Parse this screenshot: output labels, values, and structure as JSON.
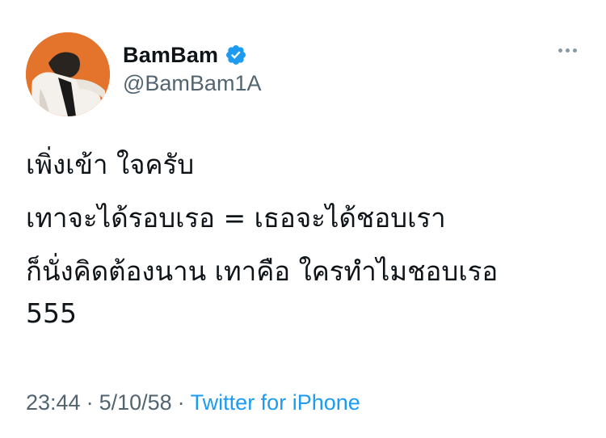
{
  "author": {
    "display_name": "BamBam",
    "handle": "@BamBam1A",
    "verified_icon": "verified-badge-icon",
    "avatar_color": "#e4732c"
  },
  "tweet": {
    "lines": [
      "เพิ่งเข้า ใจครับ",
      "เทาจะได้รอบเรอ = เธอจะได้ชอบเรา",
      "ก็นั่งคิดต้องนาน เทาคือ ใครทำไมชอบเรอ",
      "555"
    ]
  },
  "meta": {
    "time": "23:44",
    "separator": "·",
    "date": "5/10/58",
    "source": "Twitter for iPhone"
  },
  "colors": {
    "accent": "#1d9bf0",
    "secondary_text": "#536471",
    "primary_text": "#0f1419"
  },
  "more_icon": "more-options-icon"
}
